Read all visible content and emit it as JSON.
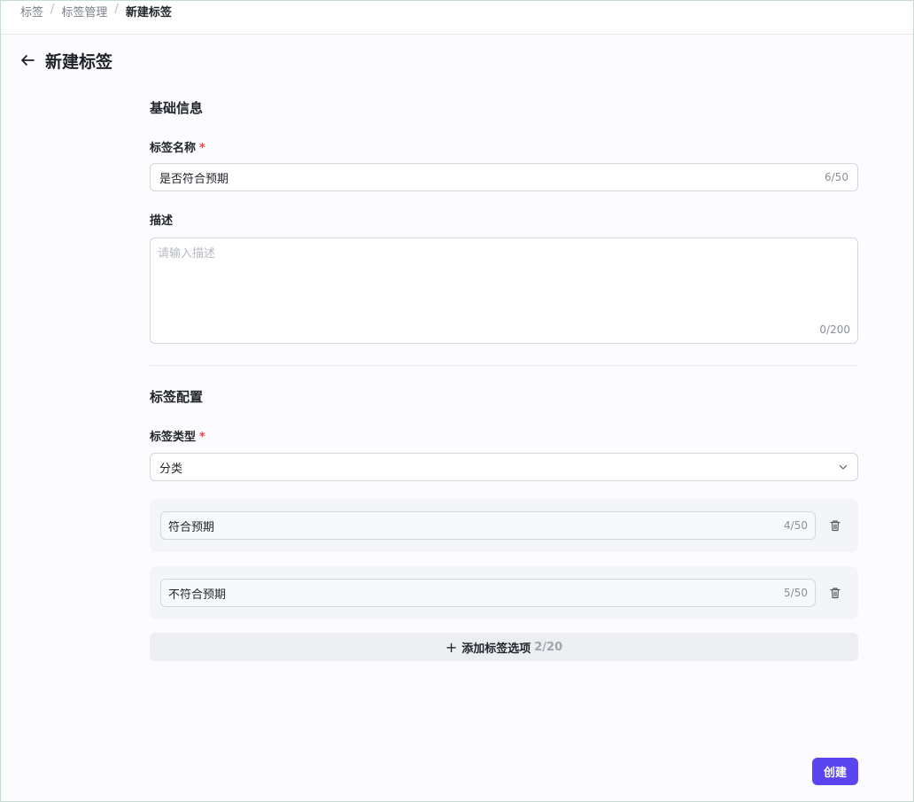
{
  "breadcrumb": {
    "items": [
      "标签",
      "标签管理"
    ],
    "separator": "/",
    "current": "新建标签"
  },
  "header": {
    "back_icon": "arrow-left-icon",
    "title": "新建标签"
  },
  "basic_info": {
    "section_title": "基础信息",
    "name_label": "标签名称",
    "required_mark": "*",
    "name_value": "是否符合预期",
    "name_counter": "6/50",
    "desc_label": "描述",
    "desc_placeholder": "请输入描述",
    "desc_value": "",
    "desc_counter": "0/200"
  },
  "tag_config": {
    "section_title": "标签配置",
    "type_label": "标签类型",
    "required_mark": "*",
    "type_value": "分类",
    "options": [
      {
        "value": "符合预期",
        "counter": "4/50"
      },
      {
        "value": "不符合预期",
        "counter": "5/50"
      }
    ],
    "add_option_icon": "plus-icon",
    "add_option_label": "添加标签选项",
    "add_option_count": "2/20"
  },
  "footer": {
    "create_label": "创建"
  },
  "colors": {
    "primary": "#5b45f0",
    "required": "#e5484d"
  }
}
